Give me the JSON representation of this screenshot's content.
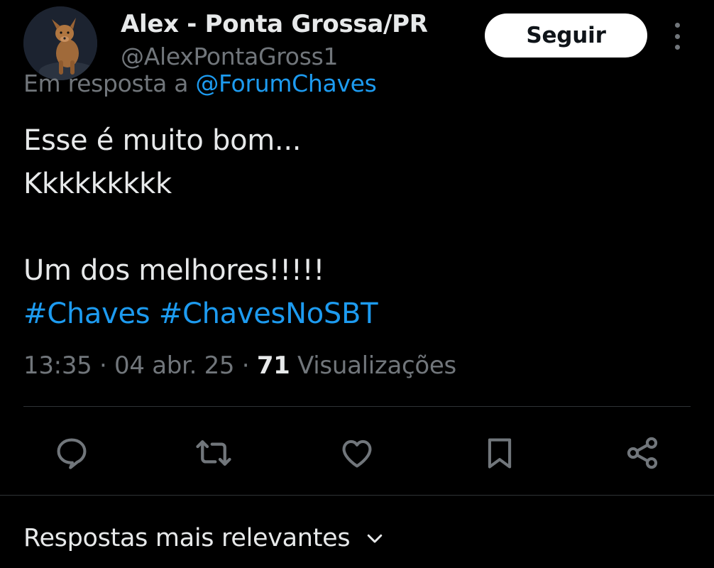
{
  "author": {
    "display_name": "Alex - Ponta Grossa/PR",
    "handle": "@AlexPontaGross1",
    "avatar_icon": "dog-photo-avatar"
  },
  "follow_button": {
    "label": "Seguir"
  },
  "more_menu": {
    "icon": "more-vertical-icon"
  },
  "reply_context": {
    "prefix": "Em resposta a",
    "mention": "@ForumChaves"
  },
  "tweet": {
    "line1": "Esse é muito bom...",
    "line2": "Kkkkkkkkk",
    "line3": "",
    "line4": "Um dos melhores!!!!!",
    "hashtag1": "#Chaves",
    "hashtag2": "#ChavesNoSBT"
  },
  "meta": {
    "time": "13:35",
    "separator": "·",
    "date": "04 abr. 25",
    "views_count": "71",
    "views_label": "Visualizações"
  },
  "actions": {
    "reply_icon": "reply-icon",
    "retweet_icon": "retweet-icon",
    "like_icon": "heart-icon",
    "bookmark_icon": "bookmark-icon",
    "share_icon": "share-icon"
  },
  "replies_sort": {
    "label": "Respostas mais relevantes",
    "icon": "chevron-down-icon"
  },
  "colors": {
    "background": "#000000",
    "text": "#e7e9ea",
    "secondary": "#71767b",
    "accent": "#1d9bf0",
    "divider": "#2f3336"
  }
}
